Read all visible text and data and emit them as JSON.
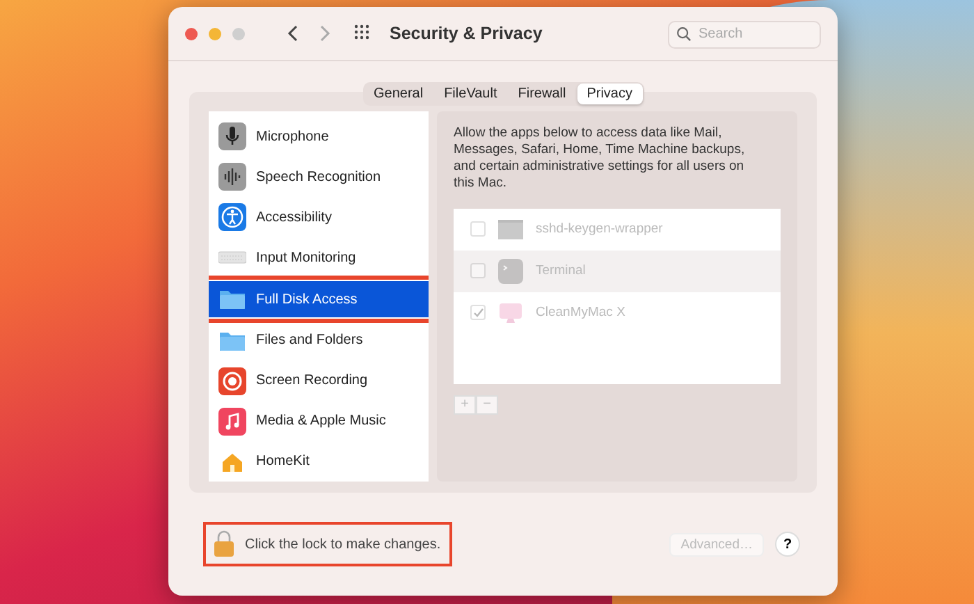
{
  "window": {
    "title": "Security & Privacy"
  },
  "search": {
    "placeholder": "Search"
  },
  "tabs": [
    {
      "label": "General",
      "selected": false
    },
    {
      "label": "FileVault",
      "selected": false
    },
    {
      "label": "Firewall",
      "selected": false
    },
    {
      "label": "Privacy",
      "selected": true
    }
  ],
  "categories": [
    {
      "label": "Microphone",
      "kind": "microphone",
      "selected": false
    },
    {
      "label": "Speech Recognition",
      "kind": "speech",
      "selected": false
    },
    {
      "label": "Accessibility",
      "kind": "accessibility",
      "selected": false
    },
    {
      "label": "Input Monitoring",
      "kind": "keyboard",
      "selected": false
    },
    {
      "label": "Full Disk Access",
      "kind": "folder",
      "selected": true
    },
    {
      "label": "Files and Folders",
      "kind": "folder",
      "selected": false
    },
    {
      "label": "Screen Recording",
      "kind": "record",
      "selected": false
    },
    {
      "label": "Media & Apple Music",
      "kind": "music",
      "selected": false
    },
    {
      "label": "HomeKit",
      "kind": "home",
      "selected": false
    }
  ],
  "description": "Allow the apps below to access data like Mail, Messages, Safari, Home, Time Machine backups, and certain administrative settings for all users on this Mac.",
  "apps": [
    {
      "name": "sshd-keygen-wrapper",
      "kind": "executable",
      "checked": false,
      "disabled": true
    },
    {
      "name": "Terminal",
      "kind": "terminal",
      "checked": false,
      "disabled": true
    },
    {
      "name": "CleanMyMac X",
      "kind": "cleaner",
      "checked": true,
      "disabled": true
    }
  ],
  "list_buttons": [
    "+",
    "−"
  ],
  "lock": {
    "text": "Click the lock to make changes."
  },
  "advanced_button": {
    "label": "Advanced…",
    "disabled": true
  },
  "help_button": {
    "label": "?"
  }
}
